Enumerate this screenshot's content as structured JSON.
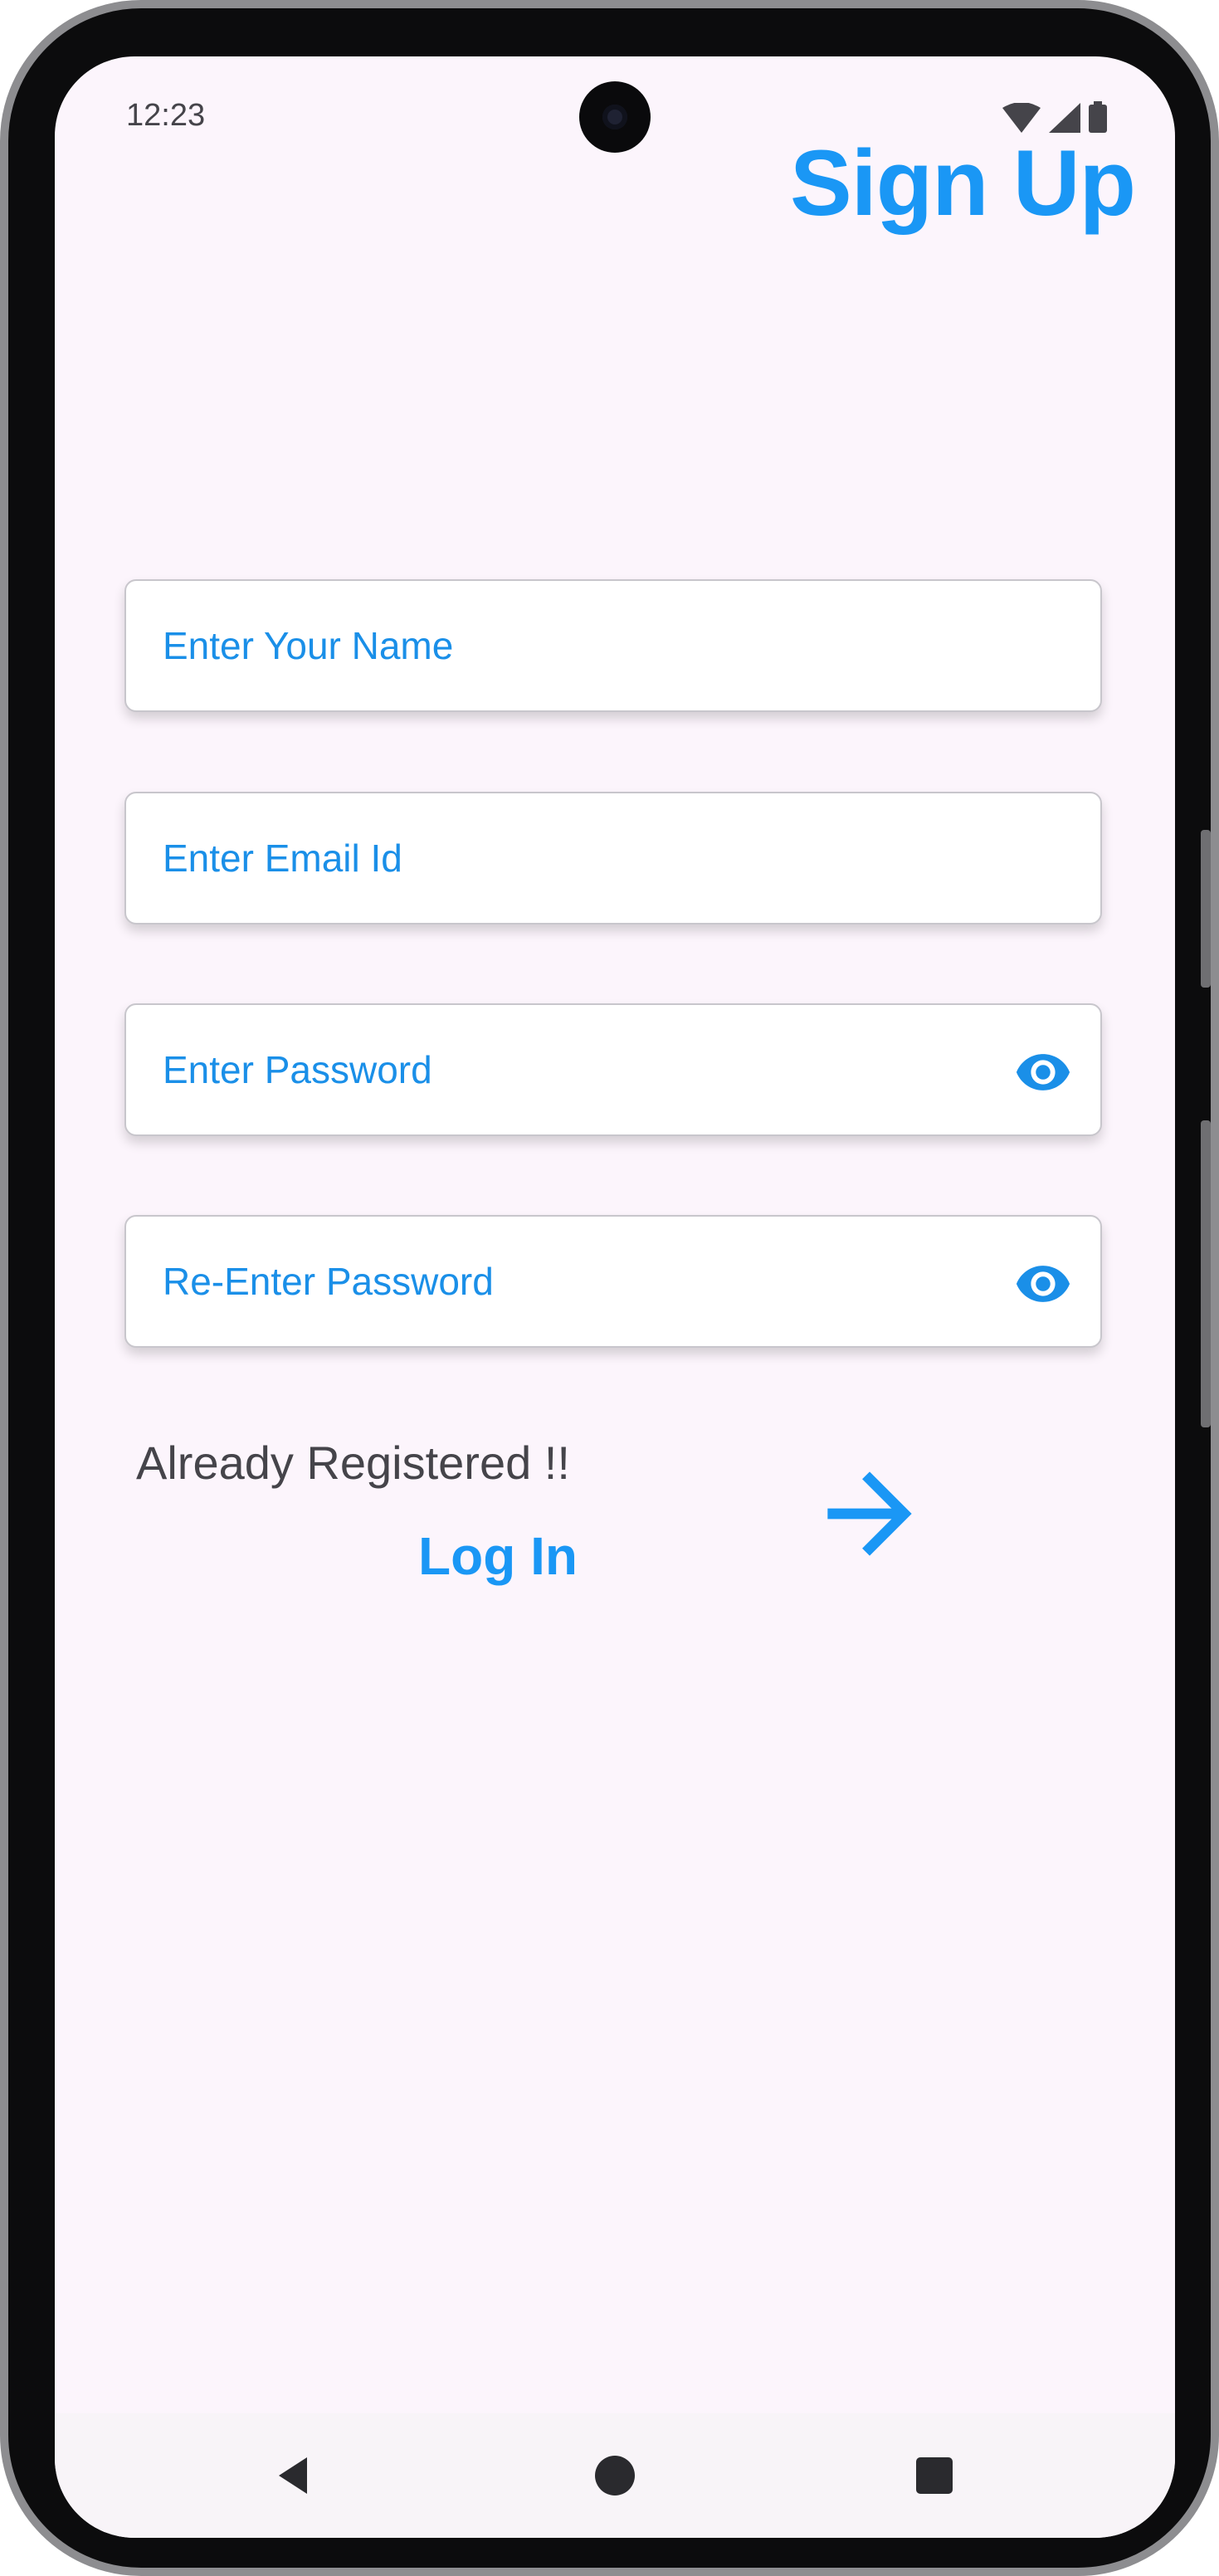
{
  "status_bar": {
    "time": "12:23",
    "icons": [
      "wifi-icon",
      "signal-icon",
      "battery-icon"
    ]
  },
  "header": {
    "title": "Sign Up"
  },
  "form": {
    "name_placeholder": "Enter Your Name",
    "email_placeholder": "Enter Email Id",
    "password_placeholder": "Enter Password",
    "confirm_password_placeholder": "Re-Enter Password",
    "password_toggle_icon": "eye-icon",
    "confirm_password_toggle_icon": "eye-icon"
  },
  "footer": {
    "already_registered_text": "Already Registered !!",
    "login_link": "Log In",
    "next_icon": "arrow-right-icon"
  },
  "nav_bar": {
    "buttons": [
      "back-triangle-icon",
      "home-circle-icon",
      "recents-square-icon"
    ]
  },
  "colors": {
    "accent": "#1a97f5",
    "background": "#fcf5fc",
    "text_dark": "#45444a"
  }
}
